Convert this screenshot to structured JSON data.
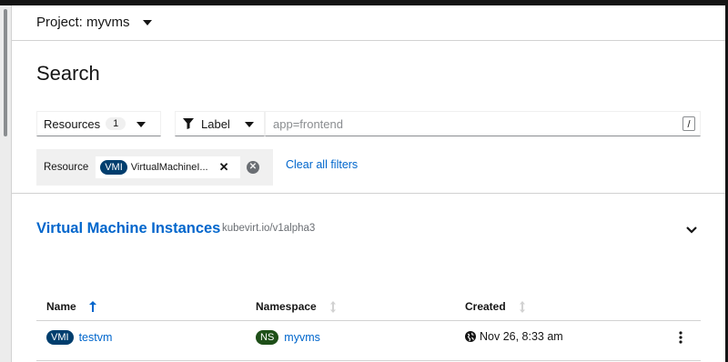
{
  "project": {
    "label": "Project: myvms"
  },
  "page": {
    "title": "Search"
  },
  "filters": {
    "resources_label": "Resources",
    "resources_count": "1",
    "label_select": "Label",
    "label_placeholder": "app=frontend",
    "shortcut_hint": "/",
    "chip_group_label": "Resource",
    "chip_badge": "VMI",
    "chip_text": "VirtualMachineI...",
    "clear_all": "Clear all filters"
  },
  "section": {
    "title": "Virtual Machine Instances",
    "api_version": "kubevirt.io/v1alpha3"
  },
  "table": {
    "columns": [
      "Name",
      "Namespace",
      "Created"
    ],
    "rows": [
      {
        "kind_badge": "VMI",
        "name": "testvm",
        "ns_badge": "NS",
        "namespace": "myvms",
        "created": "Nov 26, 8:33 am"
      }
    ]
  },
  "colors": {
    "link": "#0066cc",
    "vmi_badge": "#003e6e",
    "ns_badge": "#1e4f18",
    "chip_group_bg": "#f0f0f0"
  },
  "icons": [
    "caret-down-icon",
    "filter-icon",
    "close-icon",
    "close-circle-icon",
    "chevron-down-icon",
    "sort-up-icon",
    "sort-icon",
    "globe-icon",
    "kebab-icon"
  ]
}
